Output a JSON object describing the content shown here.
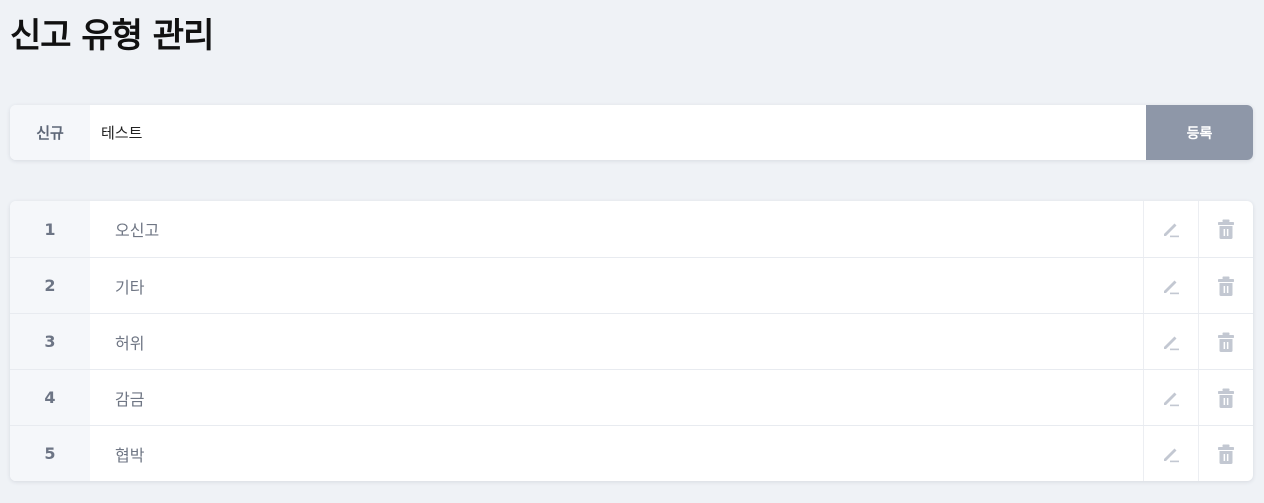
{
  "page": {
    "title": "신고 유형 관리"
  },
  "new_entry": {
    "label": "신규",
    "value": "테스트",
    "submit_label": "등록"
  },
  "report_types": [
    {
      "number": "1",
      "name": "오신고"
    },
    {
      "number": "2",
      "name": "기타"
    },
    {
      "number": "3",
      "name": "허위"
    },
    {
      "number": "4",
      "name": "감금"
    },
    {
      "number": "5",
      "name": "협박"
    }
  ],
  "icons": {
    "edit": "pencil-icon",
    "delete": "trash-icon"
  },
  "colors": {
    "background": "#eff2f6",
    "button": "#8e97a8",
    "icon": "#c3c8d2"
  }
}
